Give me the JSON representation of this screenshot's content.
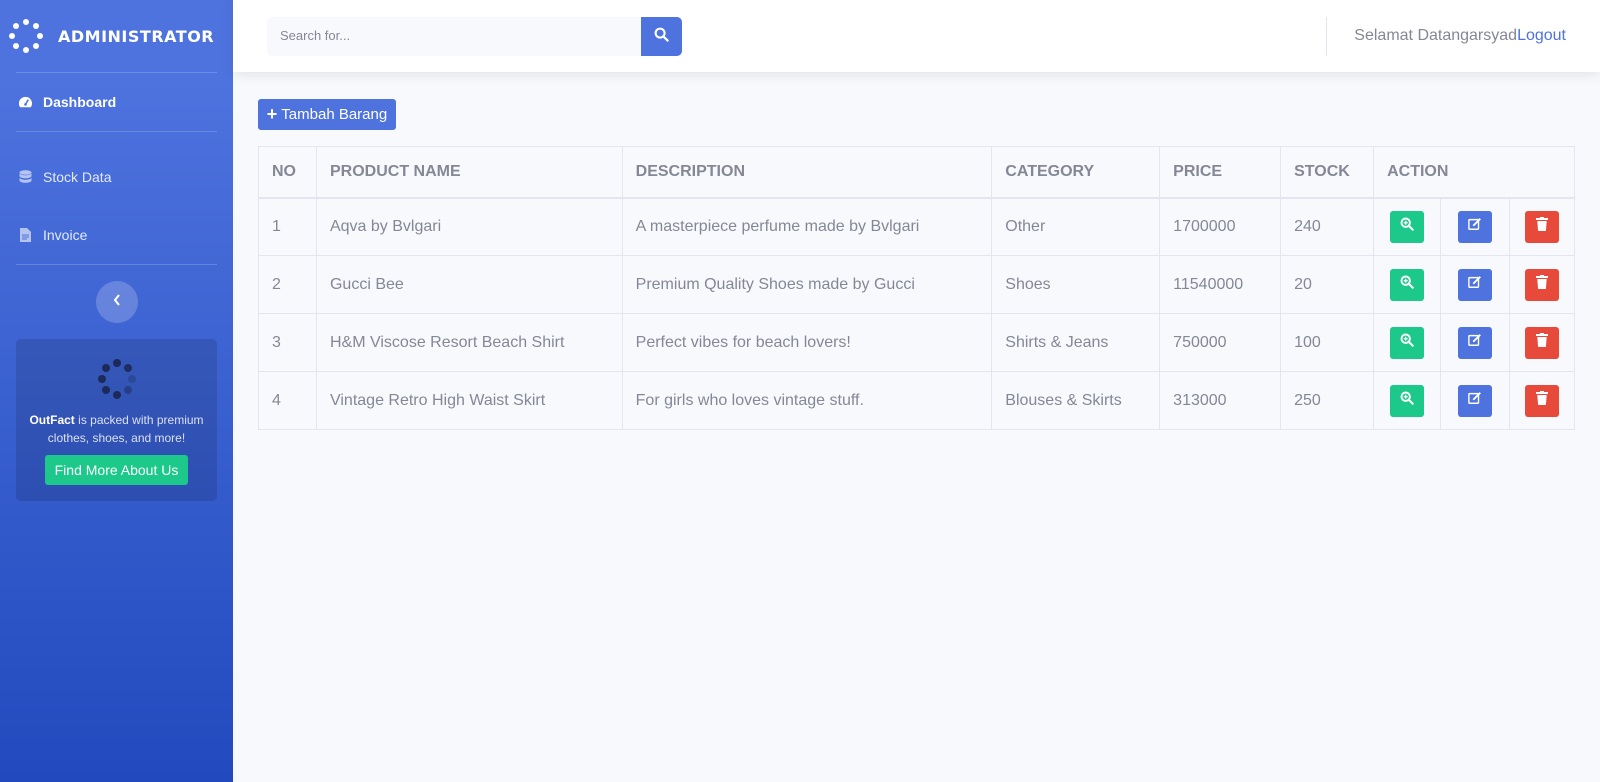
{
  "sidebar": {
    "brand": "ADMINISTRATOR",
    "items": [
      {
        "label": "Dashboard",
        "icon": "tachometer-icon",
        "active": true
      },
      {
        "label": "Stock Data",
        "icon": "database-icon",
        "active": false
      },
      {
        "label": "Invoice",
        "icon": "file-icon",
        "active": false
      }
    ],
    "promo": {
      "brand": "OutFact",
      "text": " is packed with premium clothes, shoes, and more!",
      "button": "Find More About Us"
    }
  },
  "topbar": {
    "search_placeholder": "Search for...",
    "greeting": "Selamat Datangarsyad",
    "logout": "Logout"
  },
  "toolbar": {
    "add_label": "Tambah Barang"
  },
  "table": {
    "headers": [
      "NO",
      "PRODUCT NAME",
      "DESCRIPTION",
      "CATEGORY",
      "PRICE",
      "STOCK",
      "ACTION"
    ],
    "rows": [
      [
        "1",
        "Aqva by Bvlgari",
        "A masterpiece perfume made by Bvlgari",
        "Other",
        "1700000",
        "240"
      ],
      [
        "2",
        "Gucci Bee",
        "Premium Quality Shoes made by Gucci",
        "Shoes",
        "11540000",
        "20"
      ],
      [
        "3",
        "H&M Viscose Resort Beach Shirt",
        "Perfect vibes for beach lovers!",
        "Shirts & Jeans",
        "750000",
        "100"
      ],
      [
        "4",
        "Vintage Retro High Waist Skirt",
        "For girls who loves vintage stuff.",
        "Blouses & Skirts",
        "313000",
        "250"
      ]
    ]
  },
  "colors": {
    "primary": "#4e73df",
    "success": "#1cc88a",
    "danger": "#e74a3b"
  }
}
